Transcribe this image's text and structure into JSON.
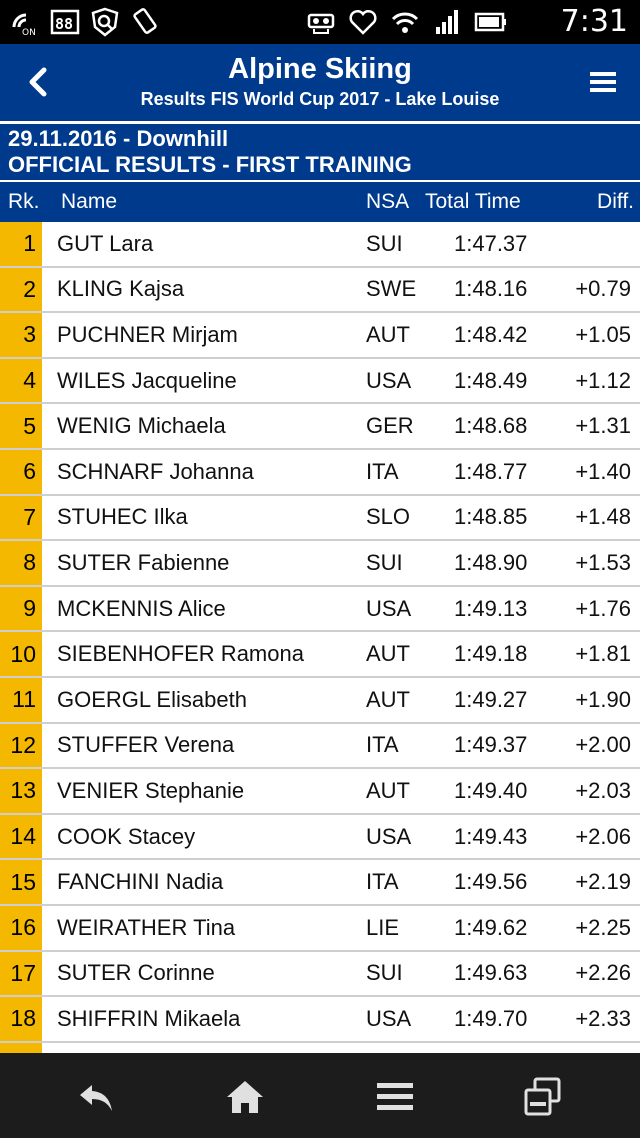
{
  "status_bar": {
    "time": "7:31",
    "left_icons": [
      "signal-on-icon",
      "sim-88-icon",
      "shield-search-icon",
      "phone-tilt-icon"
    ],
    "right_icons": [
      "headset-icon",
      "heart-icon",
      "wifi-icon",
      "cell-signal-icon",
      "battery-icon"
    ]
  },
  "header": {
    "title": "Alpine Skiing",
    "subtitle": "Results FIS World Cup 2017 - Lake Louise"
  },
  "info": {
    "date_event": "29.11.2016 - Downhill",
    "results_type": "OFFICIAL RESULTS - FIRST TRAINING"
  },
  "columns": {
    "rank": "Rk.",
    "name": "Name",
    "nsa": "NSA",
    "total_time": "Total Time",
    "diff": "Diff."
  },
  "results": [
    {
      "rank": "1",
      "name": "GUT Lara",
      "nsa": "SUI",
      "time": "1:47.37",
      "diff": ""
    },
    {
      "rank": "2",
      "name": "KLING Kajsa",
      "nsa": "SWE",
      "time": "1:48.16",
      "diff": "+0.79"
    },
    {
      "rank": "3",
      "name": "PUCHNER Mirjam",
      "nsa": "AUT",
      "time": "1:48.42",
      "diff": "+1.05"
    },
    {
      "rank": "4",
      "name": "WILES Jacqueline",
      "nsa": "USA",
      "time": "1:48.49",
      "diff": "+1.12"
    },
    {
      "rank": "5",
      "name": "WENIG Michaela",
      "nsa": "GER",
      "time": "1:48.68",
      "diff": "+1.31"
    },
    {
      "rank": "6",
      "name": "SCHNARF Johanna",
      "nsa": "ITA",
      "time": "1:48.77",
      "diff": "+1.40"
    },
    {
      "rank": "7",
      "name": "STUHEC Ilka",
      "nsa": "SLO",
      "time": "1:48.85",
      "diff": "+1.48"
    },
    {
      "rank": "8",
      "name": "SUTER Fabienne",
      "nsa": "SUI",
      "time": "1:48.90",
      "diff": "+1.53"
    },
    {
      "rank": "9",
      "name": "MCKENNIS Alice",
      "nsa": "USA",
      "time": "1:49.13",
      "diff": "+1.76"
    },
    {
      "rank": "10",
      "name": "SIEBENHOFER Ramona",
      "nsa": "AUT",
      "time": "1:49.18",
      "diff": "+1.81"
    },
    {
      "rank": "11",
      "name": "GOERGL Elisabeth",
      "nsa": "AUT",
      "time": "1:49.27",
      "diff": "+1.90"
    },
    {
      "rank": "12",
      "name": "STUFFER Verena",
      "nsa": "ITA",
      "time": "1:49.37",
      "diff": "+2.00"
    },
    {
      "rank": "13",
      "name": "VENIER Stephanie",
      "nsa": "AUT",
      "time": "1:49.40",
      "diff": "+2.03"
    },
    {
      "rank": "14",
      "name": "COOK Stacey",
      "nsa": "USA",
      "time": "1:49.43",
      "diff": "+2.06"
    },
    {
      "rank": "15",
      "name": "FANCHINI Nadia",
      "nsa": "ITA",
      "time": "1:49.56",
      "diff": "+2.19"
    },
    {
      "rank": "16",
      "name": "WEIRATHER Tina",
      "nsa": "LIE",
      "time": "1:49.62",
      "diff": "+2.25"
    },
    {
      "rank": "17",
      "name": "SUTER Corinne",
      "nsa": "SUI",
      "time": "1:49.63",
      "diff": "+2.26"
    },
    {
      "rank": "18",
      "name": "SHIFFRIN Mikaela",
      "nsa": "USA",
      "time": "1:49.70",
      "diff": "+2.33"
    }
  ],
  "colors": {
    "header_blue": "#003a8c",
    "rank_yellow": "#f5b800",
    "nav_bar": "#1c1c1c"
  },
  "nav": {
    "icons": [
      "back-arrow-icon",
      "home-icon",
      "menu-lines-icon",
      "recent-apps-icon"
    ]
  }
}
